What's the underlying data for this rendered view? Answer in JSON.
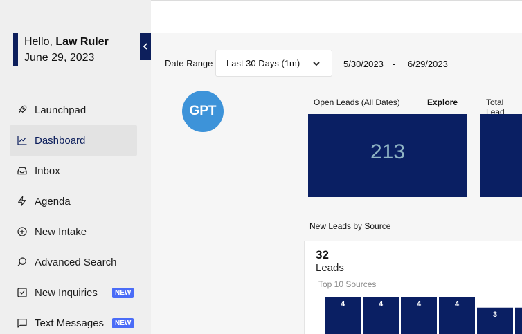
{
  "user": {
    "greeting": "Hello,",
    "name": "Law Ruler",
    "date": "June 29, 2023"
  },
  "sidebar": {
    "items": [
      {
        "label": "Launchpad",
        "icon": "rocket-icon",
        "active": false,
        "badge": ""
      },
      {
        "label": "Dashboard",
        "icon": "chart-line-icon",
        "active": true,
        "badge": ""
      },
      {
        "label": "Inbox",
        "icon": "inbox-icon",
        "active": false,
        "badge": ""
      },
      {
        "label": "Agenda",
        "icon": "bolt-icon",
        "active": false,
        "badge": ""
      },
      {
        "label": "New Intake",
        "icon": "plus-circle-icon",
        "active": false,
        "badge": ""
      },
      {
        "label": "Advanced Search",
        "icon": "search-icon",
        "active": false,
        "badge": ""
      },
      {
        "label": "New Inquiries",
        "icon": "checkbox-icon",
        "active": false,
        "badge": "NEW"
      },
      {
        "label": "Text Messages",
        "icon": "message-icon",
        "active": false,
        "badge": "NEW"
      }
    ]
  },
  "filters": {
    "range_label": "Date Range",
    "range_value": "Last 30 Days (1m)",
    "date_from": "5/30/2023",
    "separator": "-",
    "date_to": "6/29/2023"
  },
  "gpt_button": "GPT",
  "cards": {
    "open_leads": {
      "title": "Open Leads (All Dates)",
      "explore": "Explore",
      "value": "213"
    },
    "total_leads": {
      "title": "Total Lead"
    }
  },
  "new_leads": {
    "section_title": "New Leads by Source",
    "total": "32",
    "unit": "Leads",
    "subtitle": "Top 10 Sources"
  },
  "chart_data": {
    "type": "bar",
    "values": [
      4,
      4,
      4,
      4,
      3,
      3
    ],
    "bar_color": "#0a1f63",
    "label_color": "#ffffff"
  },
  "colors": {
    "navy": "#0a1f63",
    "accent_blue": "#3d93d9",
    "badge_blue": "#4a6cf7"
  }
}
